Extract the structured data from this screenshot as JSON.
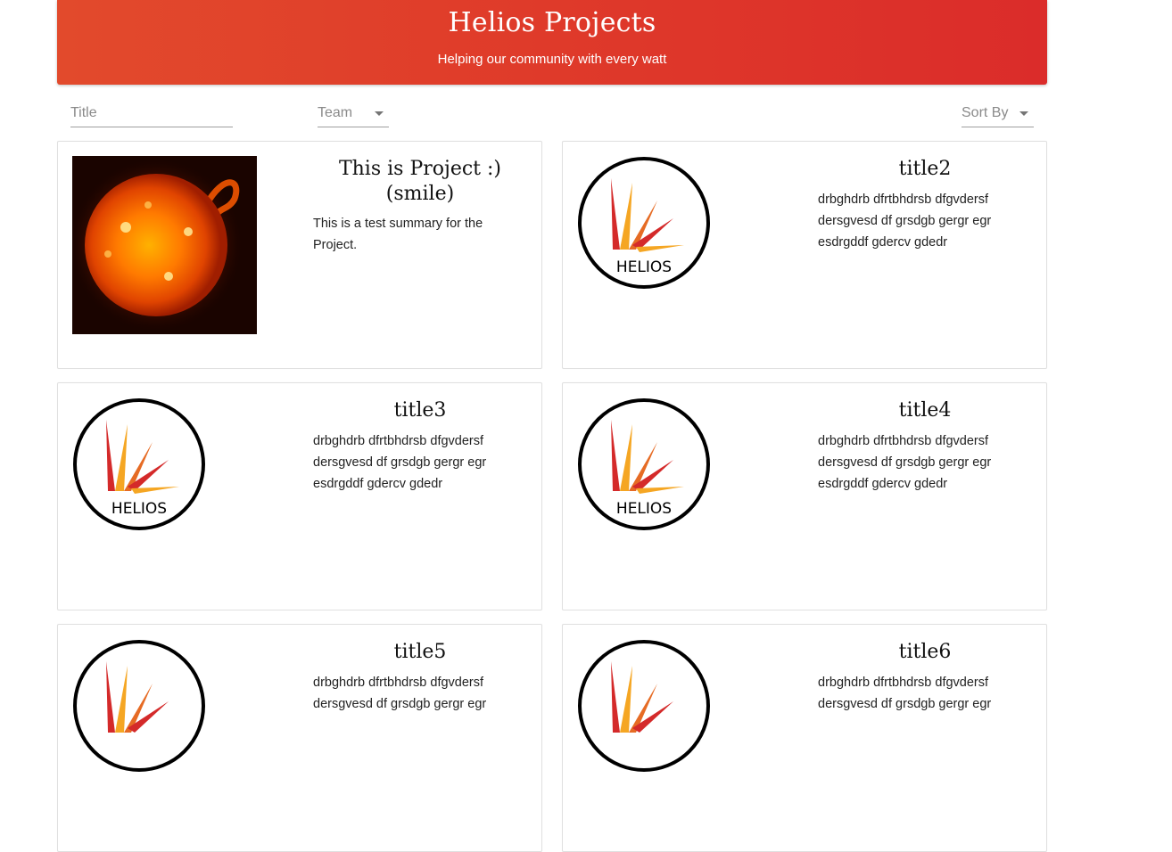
{
  "header": {
    "title": "Helios Projects",
    "subtitle": "Helping our community with every watt"
  },
  "filters": {
    "title_placeholder": "Title",
    "team_label": "Team",
    "sort_label": "Sort By"
  },
  "logo_text": "HELIOS",
  "projects": [
    {
      "title": "This is Project :) (smile)",
      "summary": "This is a test summary for the Project.",
      "image": "sun-photo"
    },
    {
      "title": "title2",
      "summary": "drbghdrb dfrtbhdrsb dfgvdersf dersgvesd df grsdgb gergr egr esdrgddf gdercv gdedr",
      "image": "helios-logo"
    },
    {
      "title": "title3",
      "summary": "drbghdrb dfrtbhdrsb dfgvdersf dersgvesd df grsdgb gergr egr esdrgddf gdercv gdedr",
      "image": "helios-logo"
    },
    {
      "title": "title4",
      "summary": "drbghdrb dfrtbhdrsb dfgvdersf dersgvesd df grsdgb gergr egr esdrgddf gdercv gdedr",
      "image": "helios-logo"
    },
    {
      "title": "title5",
      "summary": "drbghdrb dfrtbhdrsb dfgvdersf dersgvesd df grsdgb gergr egr",
      "image": "helios-logo"
    },
    {
      "title": "title6",
      "summary": "drbghdrb dfrtbhdrsb dfgvdersf dersgvesd df grsdgb gergr egr",
      "image": "helios-logo"
    }
  ]
}
